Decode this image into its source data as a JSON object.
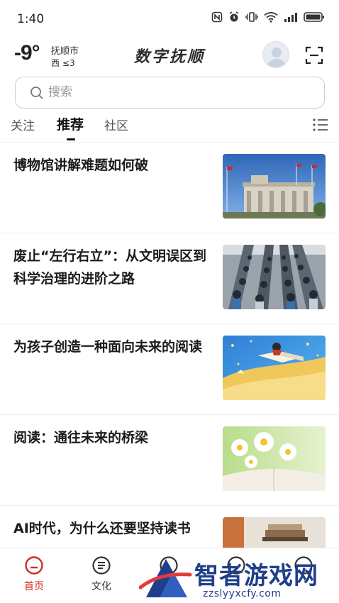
{
  "status_bar": {
    "time": "1:40"
  },
  "header": {
    "temperature": "-9°",
    "city": "抚顺市",
    "wind": "西 ≤3",
    "brand": "数字抚顺"
  },
  "search": {
    "placeholder": "搜索"
  },
  "tabs": [
    {
      "label": "关注",
      "active": false
    },
    {
      "label": "推荐",
      "active": true
    },
    {
      "label": "社区",
      "active": false
    }
  ],
  "feed": [
    {
      "title": "博物馆讲解难题如何破",
      "image": "museum-building-with-flags"
    },
    {
      "title": "废止“左行右立”：从文明误区到科学治理的进阶之路",
      "image": "crowded-escalators"
    },
    {
      "title": "为孩子创造一种面向未来的阅读",
      "image": "child-reading-on-flying-book-illustration"
    },
    {
      "title": "阅读：通往未来的桥梁",
      "image": "daisies-over-open-book"
    },
    {
      "title": "AI时代，为什么还要坚持读书",
      "image": "books-on-table"
    }
  ],
  "bottom_nav": [
    {
      "label": "首页",
      "active": true
    },
    {
      "label": "文化",
      "active": false
    },
    {
      "label": "",
      "active": false
    },
    {
      "label": "",
      "active": false
    },
    {
      "label": "",
      "active": false
    }
  ],
  "watermark": {
    "text": "智者游戏网",
    "url": "zzslyyxcfy.com"
  },
  "colors": {
    "accent": "#d12a2a",
    "watermark": "#1f3f8a"
  }
}
